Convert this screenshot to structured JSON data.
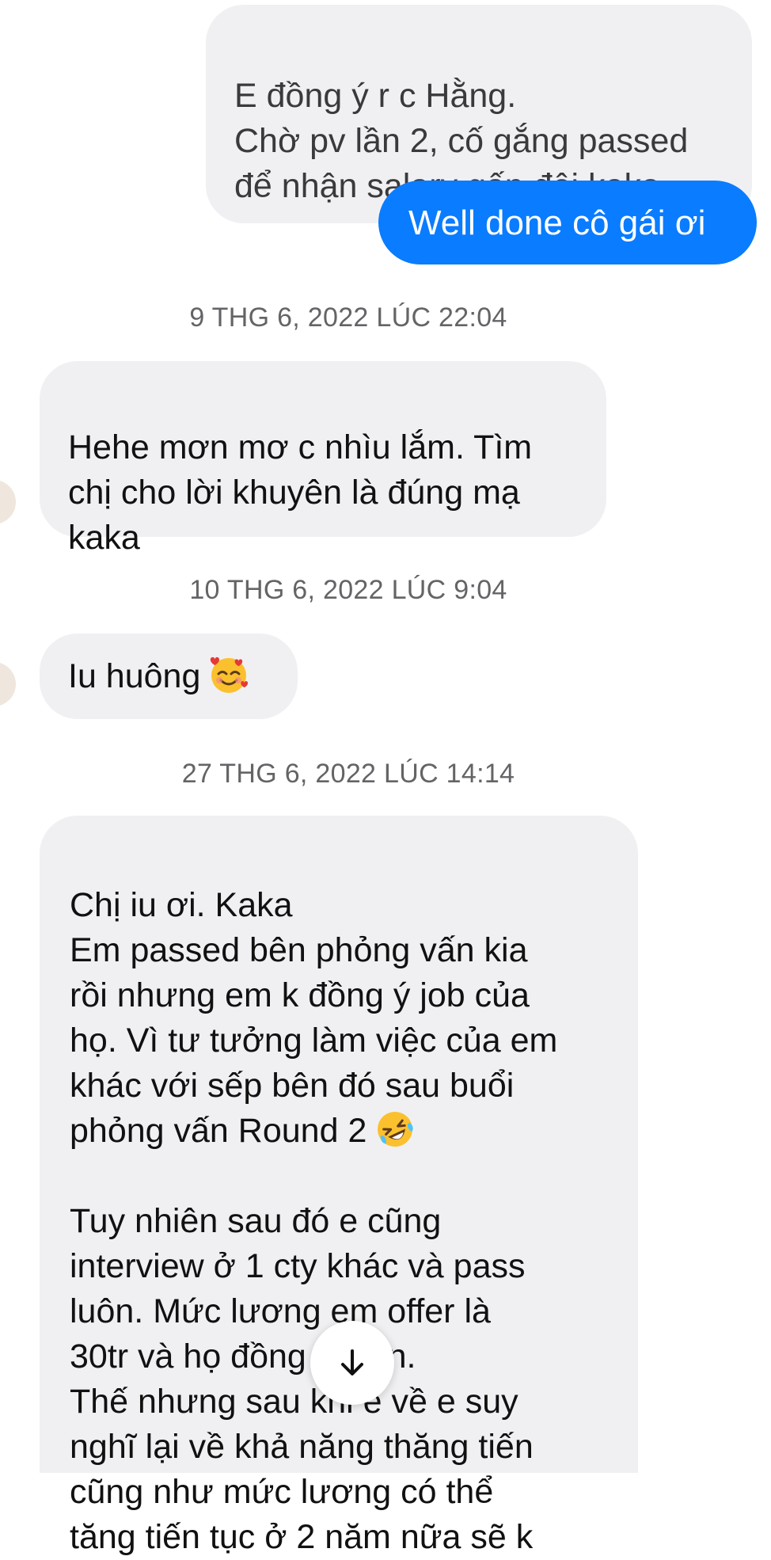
{
  "messages": [
    {
      "kind": "outgoing",
      "text": "E đồng ý r c Hằng.\nChờ pv lần 2, cố gắng passed\nđể nhận salary gấp đôi kaka"
    },
    {
      "kind": "outgoing-accent",
      "text": "Well done cô gái ơi"
    },
    {
      "kind": "timestamp",
      "text": "9 THG 6, 2022 LÚC 22:04"
    },
    {
      "kind": "incoming",
      "text": "Hehe mơn mơ c nhìu lắm. Tìm\nchị cho lời khuyên là đúng mạ\nkaka"
    },
    {
      "kind": "timestamp",
      "text": "10 THG 6, 2022 LÚC 9:04"
    },
    {
      "kind": "incoming",
      "text": "Iu huông",
      "emoji": "smiling-face-with-hearts-icon"
    },
    {
      "kind": "timestamp",
      "text": "27 THG 6, 2022 LÚC 14:14"
    },
    {
      "kind": "incoming",
      "text_before_emoji": "Chị iu ơi. Kaka\nEm passed bên phỏng vấn kia\nrồi nhưng em k đồng ý job của\nhọ. Vì tư tưởng làm việc của em\nkhác với sếp bên đó sau buổi\nphỏng vấn Round 2",
      "emoji": "rolling-on-floor-laughing-icon",
      "text_after_emoji": "Tuy nhiên sau đó e cũng\ninterview ở 1 cty khác và pass\nluôn. Mức lương em offer là\n30tr và họ đồng ý luôn.\nThế nhưng sau khi e về e suy\nnghĩ lại về khả năng thăng tiến\ncũng như mức lương có thể\ntăng tiến tục ở 2 năm nữa sẽ k"
    }
  ],
  "scroll_button": {
    "icon": "arrow-down-icon"
  },
  "colors": {
    "accent": "#0a7cff",
    "bubble_gray": "#f0f0f3",
    "timestamp_text": "#646468",
    "outgoing_gray_text": "#3a3a3c"
  }
}
